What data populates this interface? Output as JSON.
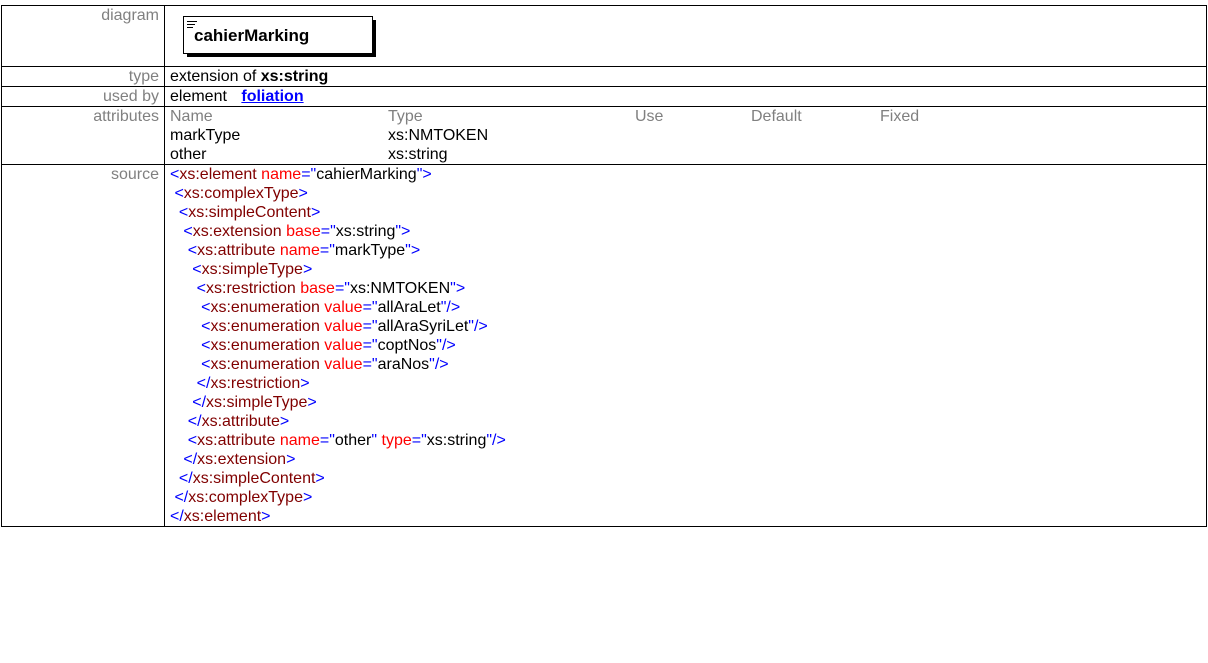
{
  "diagram": {
    "label": "diagram",
    "element_name": "cahierMarking"
  },
  "type": {
    "label": "type",
    "prefix": "extension of ",
    "base": "xs:string"
  },
  "used_by": {
    "label": "used by",
    "kind": "element",
    "link": "foliation"
  },
  "attributes": {
    "label": "attributes",
    "headers": [
      "Name",
      "Type",
      "Use",
      "Default",
      "Fixed"
    ],
    "rows": [
      [
        "markType",
        "xs:NMTOKEN",
        "",
        "",
        ""
      ],
      [
        "other",
        "xs:string",
        "",
        "",
        ""
      ]
    ]
  },
  "source": {
    "label": "source",
    "lines": [
      {
        "indent": "",
        "parts": [
          [
            "t",
            "<"
          ],
          [
            "tn",
            "xs:element"
          ],
          [
            "an",
            " name"
          ],
          [
            "t",
            "=\""
          ],
          [
            "av",
            "cahierMarking"
          ],
          [
            "t",
            "\">"
          ]
        ]
      },
      {
        "indent": " ",
        "parts": [
          [
            "t",
            "<"
          ],
          [
            "tn",
            "xs:complexType"
          ],
          [
            "t",
            ">"
          ]
        ]
      },
      {
        "indent": "  ",
        "parts": [
          [
            "t",
            "<"
          ],
          [
            "tn",
            "xs:simpleContent"
          ],
          [
            "t",
            ">"
          ]
        ]
      },
      {
        "indent": "   ",
        "parts": [
          [
            "t",
            "<"
          ],
          [
            "tn",
            "xs:extension"
          ],
          [
            "an",
            " base"
          ],
          [
            "t",
            "=\""
          ],
          [
            "av",
            "xs:string"
          ],
          [
            "t",
            "\">"
          ]
        ]
      },
      {
        "indent": "    ",
        "parts": [
          [
            "t",
            "<"
          ],
          [
            "tn",
            "xs:attribute"
          ],
          [
            "an",
            " name"
          ],
          [
            "t",
            "=\""
          ],
          [
            "av",
            "markType"
          ],
          [
            "t",
            "\">"
          ]
        ]
      },
      {
        "indent": "     ",
        "parts": [
          [
            "t",
            "<"
          ],
          [
            "tn",
            "xs:simpleType"
          ],
          [
            "t",
            ">"
          ]
        ]
      },
      {
        "indent": "      ",
        "parts": [
          [
            "t",
            "<"
          ],
          [
            "tn",
            "xs:restriction"
          ],
          [
            "an",
            " base"
          ],
          [
            "t",
            "=\""
          ],
          [
            "av",
            "xs:NMTOKEN"
          ],
          [
            "t",
            "\">"
          ]
        ]
      },
      {
        "indent": "       ",
        "parts": [
          [
            "t",
            "<"
          ],
          [
            "tn",
            "xs:enumeration"
          ],
          [
            "an",
            " value"
          ],
          [
            "t",
            "=\""
          ],
          [
            "av",
            "allAraLet"
          ],
          [
            "t",
            "\"/>"
          ]
        ]
      },
      {
        "indent": "       ",
        "parts": [
          [
            "t",
            "<"
          ],
          [
            "tn",
            "xs:enumeration"
          ],
          [
            "an",
            " value"
          ],
          [
            "t",
            "=\""
          ],
          [
            "av",
            "allAraSyriLet"
          ],
          [
            "t",
            "\"/>"
          ]
        ]
      },
      {
        "indent": "       ",
        "parts": [
          [
            "t",
            "<"
          ],
          [
            "tn",
            "xs:enumeration"
          ],
          [
            "an",
            " value"
          ],
          [
            "t",
            "=\""
          ],
          [
            "av",
            "coptNos"
          ],
          [
            "t",
            "\"/>"
          ]
        ]
      },
      {
        "indent": "       ",
        "parts": [
          [
            "t",
            "<"
          ],
          [
            "tn",
            "xs:enumeration"
          ],
          [
            "an",
            " value"
          ],
          [
            "t",
            "=\""
          ],
          [
            "av",
            "araNos"
          ],
          [
            "t",
            "\"/>"
          ]
        ]
      },
      {
        "indent": "      ",
        "parts": [
          [
            "t",
            "</"
          ],
          [
            "tn",
            "xs:restriction"
          ],
          [
            "t",
            ">"
          ]
        ]
      },
      {
        "indent": "     ",
        "parts": [
          [
            "t",
            "</"
          ],
          [
            "tn",
            "xs:simpleType"
          ],
          [
            "t",
            ">"
          ]
        ]
      },
      {
        "indent": "    ",
        "parts": [
          [
            "t",
            "</"
          ],
          [
            "tn",
            "xs:attribute"
          ],
          [
            "t",
            ">"
          ]
        ]
      },
      {
        "indent": "    ",
        "parts": [
          [
            "t",
            "<"
          ],
          [
            "tn",
            "xs:attribute"
          ],
          [
            "an",
            " name"
          ],
          [
            "t",
            "=\""
          ],
          [
            "av",
            "other"
          ],
          [
            "t",
            "\""
          ],
          [
            "an",
            " type"
          ],
          [
            "t",
            "=\""
          ],
          [
            "av",
            "xs:string"
          ],
          [
            "t",
            "\"/>"
          ]
        ]
      },
      {
        "indent": "   ",
        "parts": [
          [
            "t",
            "</"
          ],
          [
            "tn",
            "xs:extension"
          ],
          [
            "t",
            ">"
          ]
        ]
      },
      {
        "indent": "  ",
        "parts": [
          [
            "t",
            "</"
          ],
          [
            "tn",
            "xs:simpleContent"
          ],
          [
            "t",
            ">"
          ]
        ]
      },
      {
        "indent": " ",
        "parts": [
          [
            "t",
            "</"
          ],
          [
            "tn",
            "xs:complexType"
          ],
          [
            "t",
            ">"
          ]
        ]
      },
      {
        "indent": "",
        "parts": [
          [
            "t",
            "</"
          ],
          [
            "tn",
            "xs:element"
          ],
          [
            "t",
            ">"
          ]
        ]
      }
    ]
  }
}
